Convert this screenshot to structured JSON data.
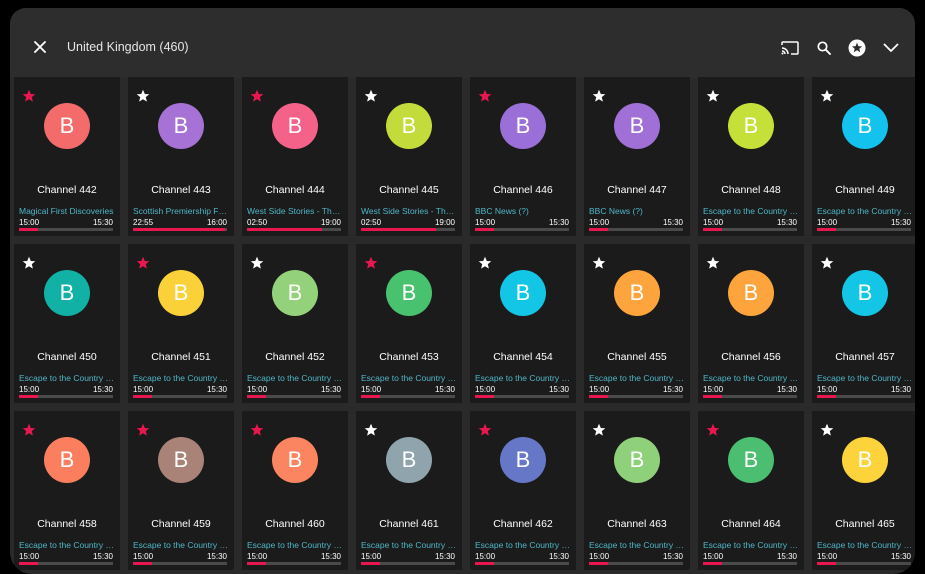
{
  "header": {
    "title": "United Kingdom (460)",
    "close_icon": "close-icon",
    "cast_icon": "cast-icon",
    "search_icon": "search-icon",
    "favorites_icon": "star-circle-icon",
    "expand_icon": "chevron-down-icon"
  },
  "colors": {
    "accent": "#e8174f",
    "program_title": "#4fb6c8",
    "card_bg": "#1b1b1b",
    "page_bg": "#2a2a2a"
  },
  "channels": [
    {
      "name": "Channel 442",
      "letter": "B",
      "color": "#f46b6b",
      "fav": true,
      "program": "Magical First Discoveries",
      "start": "15:00",
      "end": "15:30",
      "progress": 0.2
    },
    {
      "name": "Channel 443",
      "letter": "B",
      "color": "#a672d5",
      "fav": false,
      "program": "Scottish Premiership Football",
      "start": "22:55",
      "end": "16:00",
      "progress": 0.98
    },
    {
      "name": "Channel 444",
      "letter": "B",
      "color": "#f4628a",
      "fav": true,
      "program": "West Side Stories - The Making",
      "start": "02:50",
      "end": "19:00",
      "progress": 0.8
    },
    {
      "name": "Channel 445",
      "letter": "B",
      "color": "#c3dc3c",
      "fav": false,
      "program": "West Side Stories - The Making",
      "start": "02:50",
      "end": "19:00",
      "progress": 0.8
    },
    {
      "name": "Channel 446",
      "letter": "B",
      "color": "#9b6fd8",
      "fav": true,
      "program": "BBC News (?)",
      "start": "15:00",
      "end": "15:30",
      "progress": 0.2
    },
    {
      "name": "Channel 447",
      "letter": "B",
      "color": "#a070d6",
      "fav": false,
      "program": "BBC News (?)",
      "start": "15:00",
      "end": "15:30",
      "progress": 0.2
    },
    {
      "name": "Channel 448",
      "letter": "B",
      "color": "#c6e03a",
      "fav": false,
      "program": "Escape to the Country (?)",
      "start": "15:00",
      "end": "15:30",
      "progress": 0.2
    },
    {
      "name": "Channel 449",
      "letter": "B",
      "color": "#14c2ee",
      "fav": false,
      "program": "Escape to the Country (?)",
      "start": "15:00",
      "end": "15:30",
      "progress": 0.2
    },
    {
      "name": "Channel 450",
      "letter": "B",
      "color": "#12b1a5",
      "fav": false,
      "program": "Escape to the Country (?)",
      "start": "15:00",
      "end": "15:30",
      "progress": 0.2
    },
    {
      "name": "Channel 451",
      "letter": "B",
      "color": "#fbd13a",
      "fav": true,
      "program": "Escape to the Country (?)",
      "start": "15:00",
      "end": "15:30",
      "progress": 0.2
    },
    {
      "name": "Channel 452",
      "letter": "B",
      "color": "#93d27a",
      "fav": false,
      "program": "Escape to the Country (?)",
      "start": "15:00",
      "end": "15:30",
      "progress": 0.2
    },
    {
      "name": "Channel 453",
      "letter": "B",
      "color": "#48c26e",
      "fav": true,
      "program": "Escape to the Country (?)",
      "start": "15:00",
      "end": "15:30",
      "progress": 0.2
    },
    {
      "name": "Channel 454",
      "letter": "B",
      "color": "#14c6e6",
      "fav": false,
      "program": "Escape to the Country (?)",
      "start": "15:00",
      "end": "15:30",
      "progress": 0.2
    },
    {
      "name": "Channel 455",
      "letter": "B",
      "color": "#fda43c",
      "fav": false,
      "program": "Escape to the Country (?)",
      "start": "15:00",
      "end": "15:30",
      "progress": 0.2
    },
    {
      "name": "Channel 456",
      "letter": "B",
      "color": "#fda43c",
      "fav": false,
      "program": "Escape to the Country (?)",
      "start": "15:00",
      "end": "15:30",
      "progress": 0.2
    },
    {
      "name": "Channel 457",
      "letter": "B",
      "color": "#14c6e6",
      "fav": false,
      "program": "Escape to the Country (?)",
      "start": "15:00",
      "end": "15:30",
      "progress": 0.2
    },
    {
      "name": "Channel 458",
      "letter": "B",
      "color": "#fb7f5f",
      "fav": true,
      "program": "Escape to the Country (?)",
      "start": "15:00",
      "end": "15:30",
      "progress": 0.2
    },
    {
      "name": "Channel 459",
      "letter": "B",
      "color": "#a98377",
      "fav": true,
      "program": "Escape to the Country (?)",
      "start": "15:00",
      "end": "15:30",
      "progress": 0.2
    },
    {
      "name": "Channel 460",
      "letter": "B",
      "color": "#fb8560",
      "fav": true,
      "program": "Escape to the Country (?)",
      "start": "15:00",
      "end": "15:30",
      "progress": 0.2
    },
    {
      "name": "Channel 461",
      "letter": "B",
      "color": "#90a4ae",
      "fav": false,
      "program": "Escape to the Country (?)",
      "start": "15:00",
      "end": "15:30",
      "progress": 0.2
    },
    {
      "name": "Channel 462",
      "letter": "B",
      "color": "#6677c8",
      "fav": true,
      "program": "Escape to the Country (?)",
      "start": "15:00",
      "end": "15:30",
      "progress": 0.2
    },
    {
      "name": "Channel 463",
      "letter": "B",
      "color": "#8fd07a",
      "fav": false,
      "program": "Escape to the Country (?)",
      "start": "15:00",
      "end": "15:30",
      "progress": 0.2
    },
    {
      "name": "Channel 464",
      "letter": "B",
      "color": "#4cbe72",
      "fav": true,
      "program": "Escape to the Country (?)",
      "start": "15:00",
      "end": "15:30",
      "progress": 0.2
    },
    {
      "name": "Channel 465",
      "letter": "B",
      "color": "#fdd33c",
      "fav": false,
      "program": "Escape to the Country (?)",
      "start": "15:00",
      "end": "15:30",
      "progress": 0.2
    }
  ]
}
